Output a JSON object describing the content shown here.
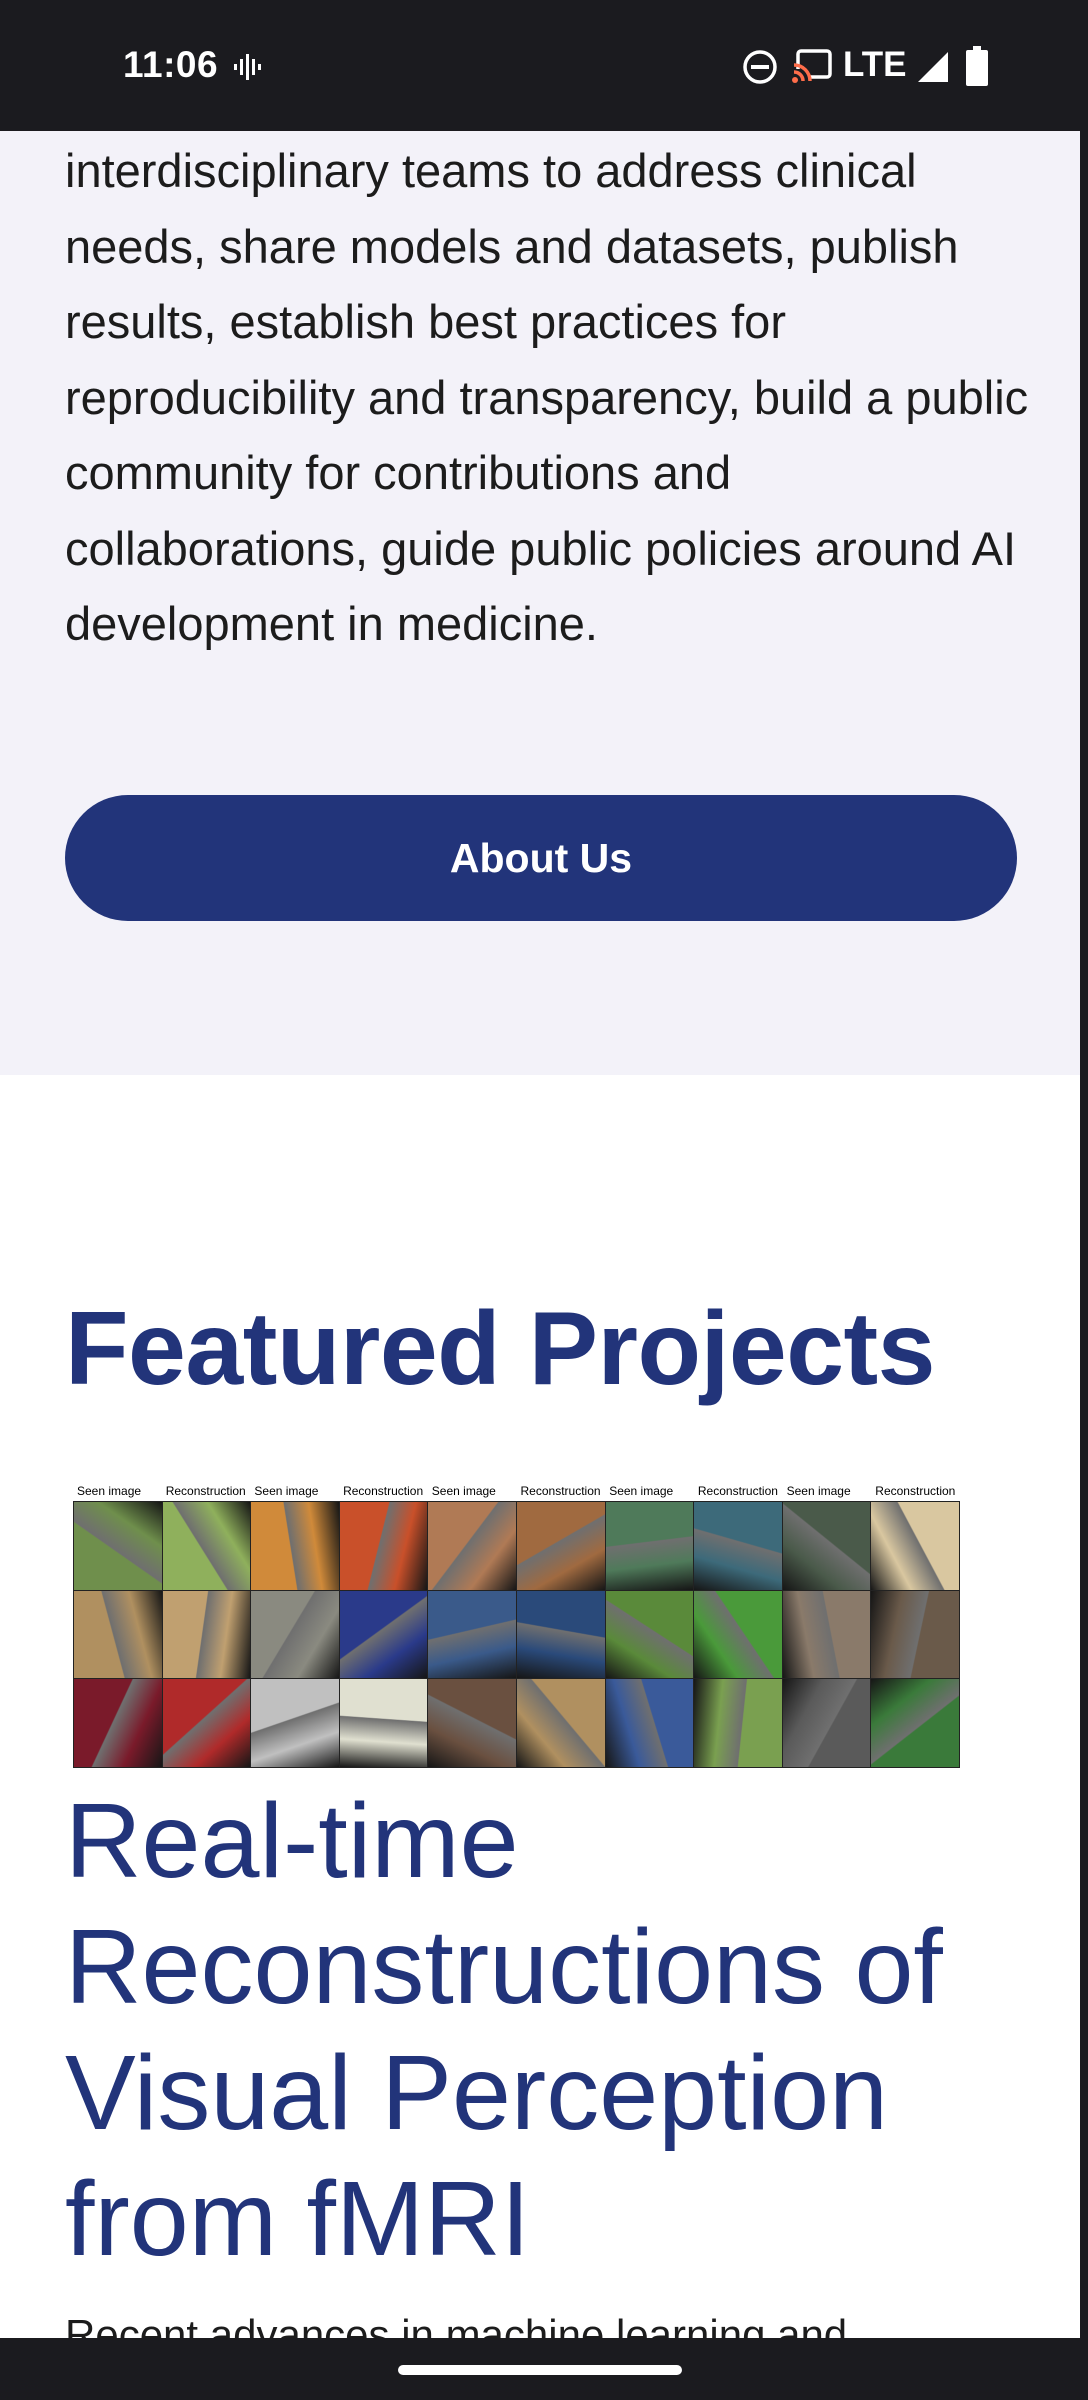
{
  "status_bar": {
    "time": "11:06",
    "network": "LTE",
    "icons": [
      "voice-wave-icon",
      "do-not-disturb-icon",
      "cast-icon",
      "signal-icon",
      "battery-icon"
    ]
  },
  "about": {
    "text": "interdisciplinary teams to address clinical needs, share models and datasets, publish results, establish best practices for reproducibility and transparency, build a public community for contributions and collaborations, guide public policies around AI development in medicine.",
    "button_label": "About Us"
  },
  "featured": {
    "heading": "Featured Projects",
    "image_column_labels": [
      "Seen image",
      "Reconstruction",
      "Seen image",
      "Reconstruction",
      "Seen image",
      "Reconstruction",
      "Seen image",
      "Reconstruction",
      "Seen image",
      "Reconstruction"
    ],
    "project_title": "Real-time Reconstructions of Visual Perception from fMRI",
    "project_description": "Recent advances in machine learning and"
  },
  "colors": {
    "brand_navy": "#22347a",
    "section_background": "#f3f2f9",
    "system_bar": "#1b1b1f"
  }
}
